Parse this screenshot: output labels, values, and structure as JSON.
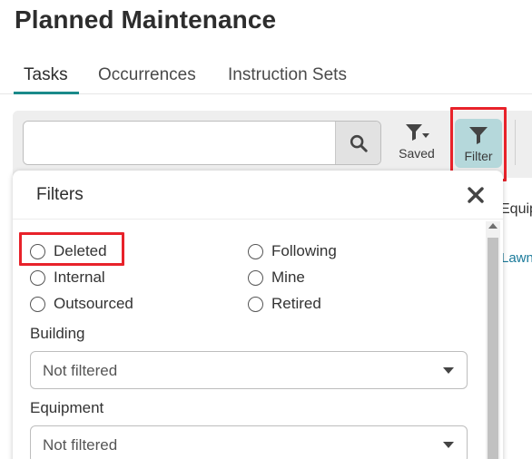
{
  "page": {
    "title": "Planned Maintenance"
  },
  "tabs": [
    {
      "label": "Tasks",
      "active": true
    },
    {
      "label": "Occurrences",
      "active": false
    },
    {
      "label": "Instruction Sets",
      "active": false
    }
  ],
  "toolbar": {
    "search": {
      "value": "",
      "placeholder": ""
    },
    "saved_label": "Saved",
    "filter_label": "Filter"
  },
  "background": {
    "column_header": "Equip",
    "link_text": "Lawn"
  },
  "filters_panel": {
    "title": "Filters",
    "options": [
      {
        "label": "Deleted",
        "checked": false
      },
      {
        "label": "Following",
        "checked": false
      },
      {
        "label": "Internal",
        "checked": false
      },
      {
        "label": "Mine",
        "checked": false
      },
      {
        "label": "Outsourced",
        "checked": false
      },
      {
        "label": "Retired",
        "checked": false
      }
    ],
    "building": {
      "label": "Building",
      "value": "Not filtered"
    },
    "equipment": {
      "label": "Equipment",
      "value": "Not filtered"
    }
  },
  "colors": {
    "accent": "#1a8a8a",
    "filter_active_bg": "#b5d8db",
    "highlight": "#e8222a",
    "link": "#1a7a9a"
  },
  "icons": {
    "search": "search-icon",
    "saved": "filter-dropdown-icon",
    "filter": "filter-icon",
    "close": "close-icon"
  }
}
